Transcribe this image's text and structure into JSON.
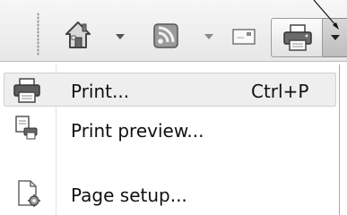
{
  "toolbar": {
    "buttons": [
      {
        "name": "home",
        "icon": "home-icon"
      },
      {
        "name": "feeds",
        "icon": "rss-feed-icon"
      },
      {
        "name": "read-mail",
        "icon": "mail-icon"
      },
      {
        "name": "print",
        "icon": "printer-icon"
      }
    ]
  },
  "menu": {
    "items": [
      {
        "label": "Print...",
        "shortcut": "Ctrl+P",
        "icon": "printer-icon",
        "highlighted": true
      },
      {
        "label": "Print preview...",
        "shortcut": "",
        "icon": "print-preview-icon",
        "highlighted": false
      },
      {
        "label": "Page setup...",
        "shortcut": "",
        "icon": "page-setup-icon",
        "highlighted": false
      }
    ]
  },
  "colors": {
    "toolbar_bg": "#ececec",
    "menu_highlight": "#eeeeee",
    "text": "#111111"
  }
}
